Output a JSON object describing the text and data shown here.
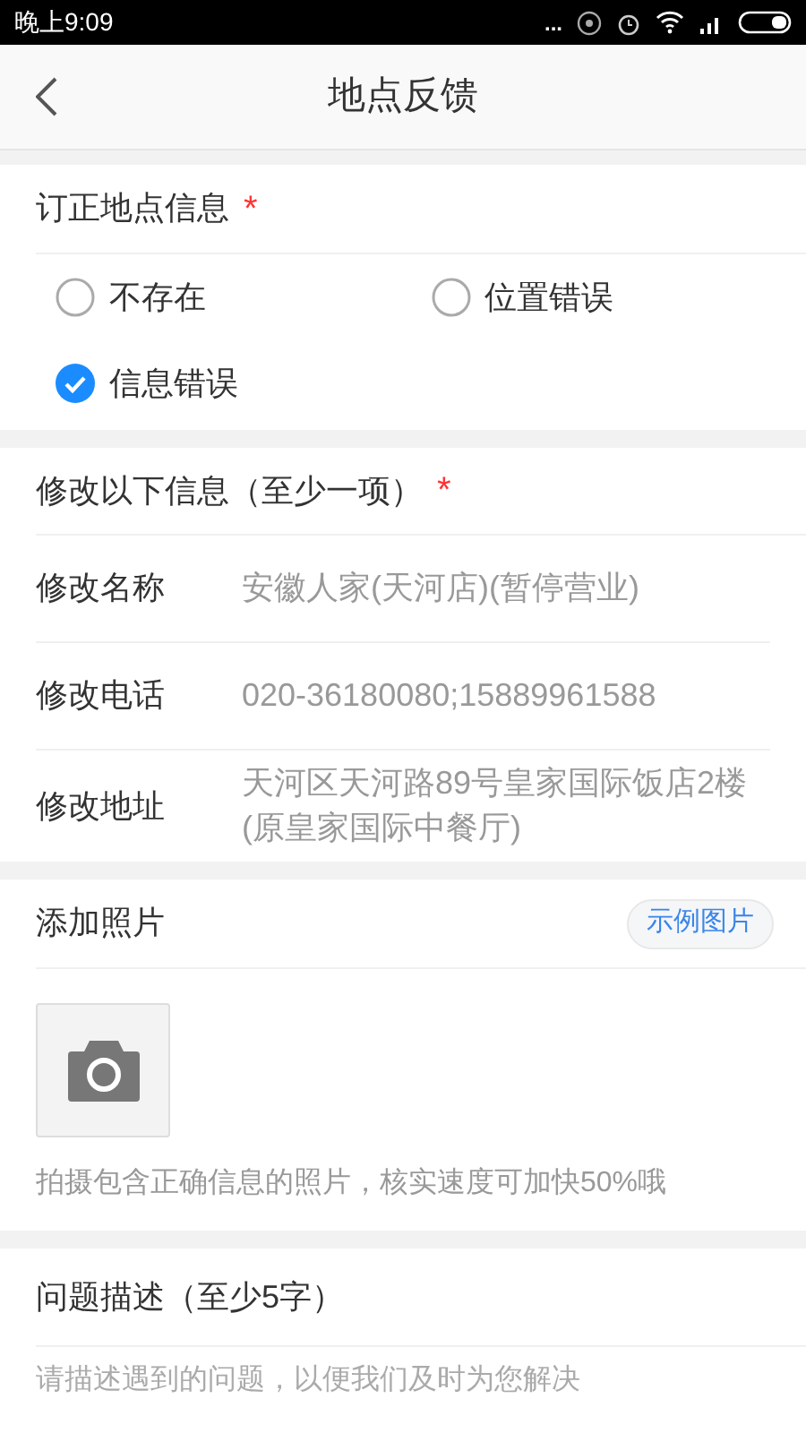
{
  "status_bar": {
    "time": "晚上9:09",
    "dots": "..."
  },
  "header": {
    "title": "地点反馈"
  },
  "correction": {
    "title": "订正地点信息",
    "required_mark": "*",
    "options": [
      {
        "label": "不存在",
        "selected": false
      },
      {
        "label": "位置错误",
        "selected": false
      },
      {
        "label": "信息错误",
        "selected": true
      }
    ]
  },
  "modify": {
    "title": "修改以下信息（至少一项）",
    "required_mark": "*",
    "fields": [
      {
        "label": "修改名称",
        "value": "安徽人家(天河店)(暂停营业)"
      },
      {
        "label": "修改电话",
        "value": "020-36180080;15889961588"
      },
      {
        "label": "修改地址",
        "value": "天河区天河路89号皇家国际饭店2楼(原皇家国际中餐厅)"
      }
    ]
  },
  "photos": {
    "title": "添加照片",
    "example_button": "示例图片",
    "hint": "拍摄包含正确信息的照片，核实速度可加快50%哦"
  },
  "description": {
    "title": "问题描述（至少5字）",
    "placeholder": "请描述遇到的问题，以便我们及时为您解决"
  }
}
